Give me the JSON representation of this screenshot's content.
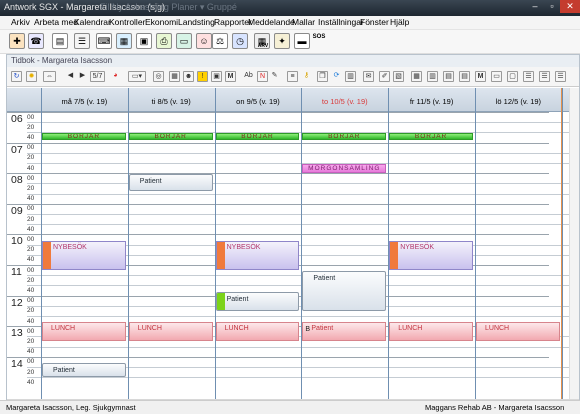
{
  "window": {
    "title": "Antwork SGX - Margareta Isacsson (sjg)",
    "ghost_text": "Fil   Ny   Avkastning   Planer ▾   Gruppé"
  },
  "menu": [
    "Arkiv",
    "Arbeta med",
    "Kalendrar",
    "Kontroller",
    "Ekonomi",
    "Landsting",
    "Rapporter",
    "Meddelande",
    "Mallar",
    "Inställningar",
    "Fönster",
    "Hjälp"
  ],
  "toolbar": {
    "icons": [
      "new-appointment-icon",
      "phone-book-icon",
      "documents-icon",
      "register-icon",
      "keyboard-icon",
      "chart-icon",
      "basket-icon",
      "printer-icon",
      "id-card-icon",
      "green-card-icon",
      "user-icon",
      "scale-icon",
      "stopwatch-icon",
      "grid-table-icon",
      "arv-icon",
      "lamp-icon",
      "book-icon",
      "sos-bell-icon"
    ],
    "arv_label": "ARV",
    "sos_label": "SOS"
  },
  "panel": {
    "title": "Tidbok - Margareta Isacsson",
    "week_label": "5/7"
  },
  "days": [
    {
      "label": "må 7/5 (v. 19)",
      "color": "#000000"
    },
    {
      "label": "ti 8/5 (v. 19)",
      "color": "#000000"
    },
    {
      "label": "on 9/5 (v. 19)",
      "color": "#000000"
    },
    {
      "label": "to 10/5 (v. 19)",
      "color": "#d93b3b"
    },
    {
      "label": "fr 11/5 (v. 19)",
      "color": "#000000"
    },
    {
      "label": "lö 12/5 (v. 19)",
      "color": "#000000"
    }
  ],
  "hours": [
    "06",
    "07",
    "08",
    "09",
    "10",
    "11",
    "12",
    "13",
    "14"
  ],
  "minutes": [
    "00",
    "20",
    "40"
  ],
  "events": [
    {
      "type": "borjar",
      "day": 0,
      "start": "06:40",
      "end": "06:50",
      "label": "BÖRJAR"
    },
    {
      "type": "borjar",
      "day": 1,
      "start": "06:40",
      "end": "06:50",
      "label": "BÖRJAR"
    },
    {
      "type": "borjar",
      "day": 2,
      "start": "06:40",
      "end": "06:50",
      "label": "BÖRJAR"
    },
    {
      "type": "borjar",
      "day": 3,
      "start": "06:40",
      "end": "06:50",
      "label": "BÖRJAR"
    },
    {
      "type": "borjar",
      "day": 4,
      "start": "06:40",
      "end": "06:50",
      "label": "BÖRJAR"
    },
    {
      "type": "morgon",
      "day": 3,
      "start": "07:40",
      "end": "07:55",
      "label": "MORGONSAMLING"
    },
    {
      "type": "patient",
      "day": 1,
      "start": "08:00",
      "end": "08:35",
      "label": "Patient"
    },
    {
      "type": "nybesok",
      "day": 0,
      "start": "10:10",
      "end": "11:10",
      "label": "NYBESÖK"
    },
    {
      "type": "nybesok",
      "day": 2,
      "start": "10:10",
      "end": "11:10",
      "label": "NYBESÖK"
    },
    {
      "type": "nybesok",
      "day": 4,
      "start": "10:10",
      "end": "11:10",
      "label": "NYBESÖK"
    },
    {
      "type": "patient",
      "day": 3,
      "start": "11:10",
      "end": "12:30",
      "label": "Patient"
    },
    {
      "type": "patient",
      "day": 2,
      "start": "11:50",
      "end": "12:30",
      "label": "Patient",
      "stripe": "green"
    },
    {
      "type": "lunch",
      "day": 0,
      "start": "12:50",
      "end": "13:30",
      "label": "LUNCH"
    },
    {
      "type": "lunch",
      "day": 1,
      "start": "12:50",
      "end": "13:30",
      "label": "LUNCH"
    },
    {
      "type": "lunch",
      "day": 2,
      "start": "12:50",
      "end": "13:30",
      "label": "LUNCH"
    },
    {
      "type": "lunch",
      "day": 3,
      "start": "12:50",
      "end": "13:30",
      "label": "Patient",
      "mark": "B"
    },
    {
      "type": "lunch",
      "day": 4,
      "start": "12:50",
      "end": "13:30",
      "label": "LUNCH"
    },
    {
      "type": "lunch",
      "day": 5,
      "start": "12:50",
      "end": "13:30",
      "label": "LUNCH"
    },
    {
      "type": "patient",
      "day": 0,
      "start": "14:10",
      "end": "14:40",
      "label": "Patient"
    }
  ],
  "status": {
    "user": "Margareta Isacsson, Leg. Sjukgymnast",
    "company": "Maggans Rehab AB - Margareta Isacsson"
  }
}
